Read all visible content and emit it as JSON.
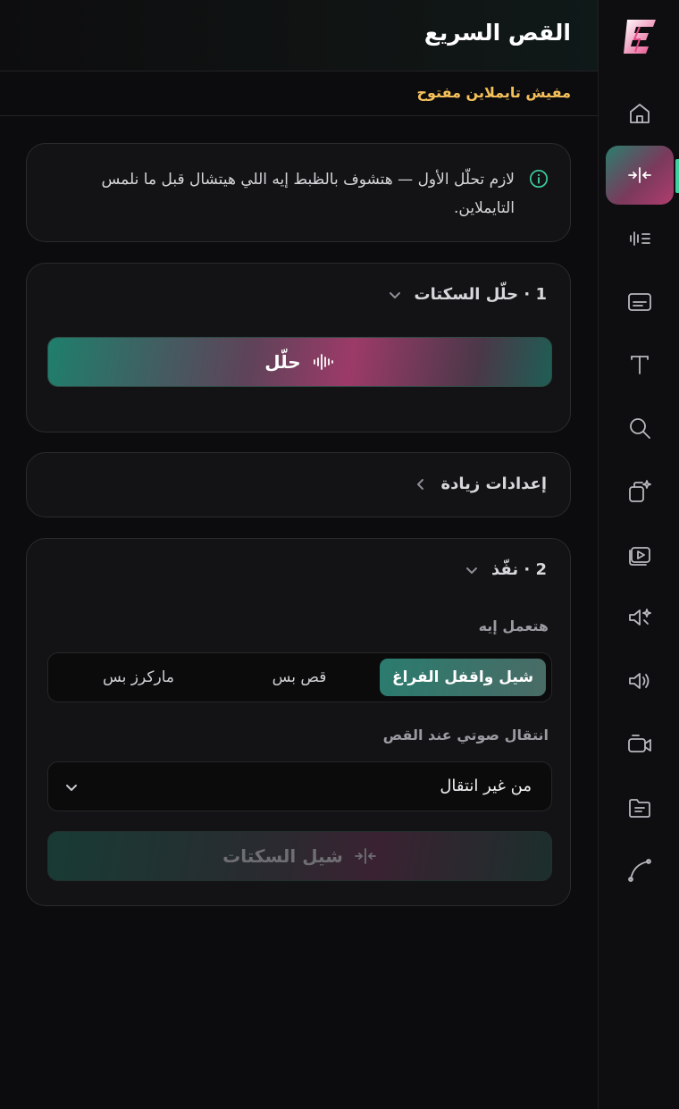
{
  "header": {
    "title": "القص السريع"
  },
  "subbar": {
    "status": "مفيش تايملاين مفتوح"
  },
  "info": {
    "text": "لازم تحلّل الأول — هتشوف بالظبط إيه اللي هيتشال قبل ما نلمس التايملاين."
  },
  "analyze": {
    "title": "1 · حلّل السكتات",
    "button_label": "حلّل"
  },
  "settings": {
    "title": "إعدادات زيادة"
  },
  "execute": {
    "title": "2 · نفّذ",
    "mode_label": "هتعمل إيه",
    "modes": [
      "شيل واقفل الفراغ",
      "قص بس",
      "ماركرز بس"
    ],
    "selected_mode": "شيل واقفل الفراغ",
    "transition_label": "انتقال صوتي عند القص",
    "transition_value": "من غير انتقال",
    "remove_button_label": "شيل السكتات"
  },
  "sidebar": {
    "items": [
      {
        "icon": "home-icon"
      },
      {
        "icon": "quick-cut-icon",
        "active": true
      },
      {
        "icon": "waveform-list-icon"
      },
      {
        "icon": "subtitles-icon"
      },
      {
        "icon": "text-icon"
      },
      {
        "icon": "search-icon"
      },
      {
        "icon": "ai-clips-icon"
      },
      {
        "icon": "media-play-icon"
      },
      {
        "icon": "ai-voice-icon"
      },
      {
        "icon": "volume-icon"
      },
      {
        "icon": "camera-icon"
      },
      {
        "icon": "folder-icon"
      },
      {
        "icon": "curve-icon"
      }
    ]
  },
  "colors": {
    "accent_teal": "#2a7e6d",
    "accent_pink": "#b03c6e",
    "warning": "#f5c15a",
    "background": "#0c0c0e"
  }
}
